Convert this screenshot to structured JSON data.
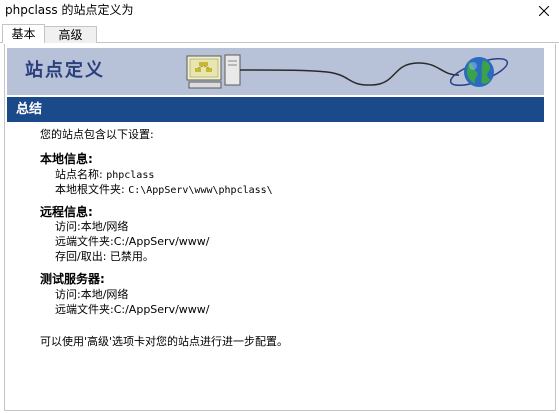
{
  "window": {
    "title": "phpclass 的站点定义为"
  },
  "tabs": [
    {
      "label": "基本",
      "selected": true
    },
    {
      "label": "高级",
      "selected": false
    }
  ],
  "banner": {
    "title": "站点定义"
  },
  "section": {
    "title": "总结"
  },
  "summary": {
    "intro": "您的站点包含以下设置:",
    "local": {
      "heading": "本地信息:",
      "site_name_label": "站点名称: ",
      "site_name_value": "phpclass",
      "root_folder_label": "本地根文件夹: ",
      "root_folder_value": "C:\\AppServ\\www\\phpclass\\"
    },
    "remote": {
      "heading": "远程信息:",
      "access": "访问:本地/网络",
      "remote_folder_label": "远端文件夹:",
      "remote_folder_value": "C:/AppServ/www/",
      "checkin": "存回/取出: 已禁用。"
    },
    "testing": {
      "heading": "测试服务器:",
      "access": "访问:本地/网络",
      "remote_folder_label": "远端文件夹:",
      "remote_folder_value": "C:/AppServ/www/"
    },
    "footer": "可以使用'高级'选项卡对您的站点进行进一步配置。"
  },
  "colors": {
    "banner_bg": "#b7c2d9",
    "section_bar": "#1a4a8a",
    "banner_title": "#2b3f7c"
  },
  "icons": [
    "close-icon",
    "computer-icon",
    "globe-icon"
  ]
}
